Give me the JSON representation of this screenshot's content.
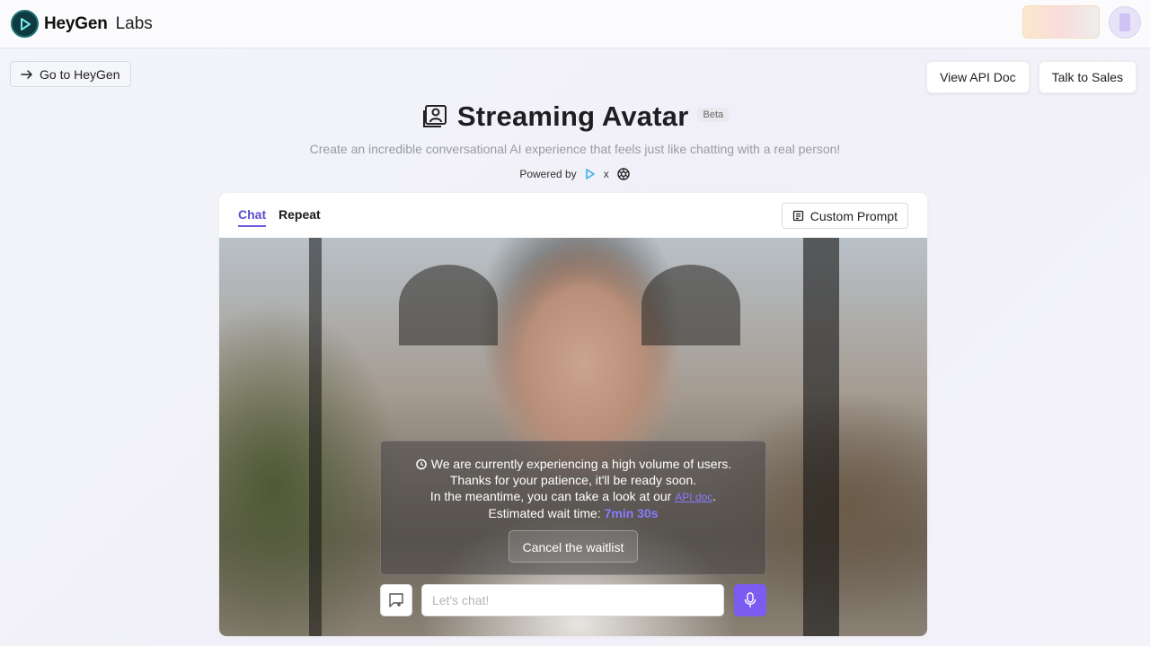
{
  "brand": {
    "name": "HeyGen",
    "suffix": "Labs"
  },
  "header": {
    "go_to": "Go to HeyGen",
    "view_api": "View API Doc",
    "talk_sales": "Talk to Sales"
  },
  "hero": {
    "title": "Streaming Avatar",
    "badge": "Beta",
    "subtitle": "Create an incredible conversational AI experience that feels just like chatting with a real person!",
    "powered_by": "Powered by",
    "times": "x"
  },
  "tabs": [
    {
      "label": "Chat",
      "active": true
    },
    {
      "label": "Repeat",
      "active": false
    }
  ],
  "custom_prompt": "Custom Prompt",
  "waitlist": {
    "line1": "We are currently experiencing a high volume of users.",
    "line2": "Thanks for your patience, it'll be ready soon.",
    "line3_pre": "In the meantime, you can take a look at our ",
    "line3_link": "API doc",
    "line3_post": ".",
    "wait_label": "Estimated wait time: ",
    "wait_time": "7min 30s",
    "cancel": "Cancel the waitlist"
  },
  "chat": {
    "placeholder": "Let's chat!"
  },
  "colors": {
    "accent": "#7b5cf0",
    "accent_text": "#5b4fd1",
    "logo_bg": "#0d3b3f"
  },
  "icons": {
    "logo": "heygen-play-icon",
    "arrow": "arrow-right-icon",
    "avatar": "avatar-card-icon",
    "prompt": "document-icon",
    "chat": "chat-add-icon",
    "mic": "microphone-icon"
  }
}
